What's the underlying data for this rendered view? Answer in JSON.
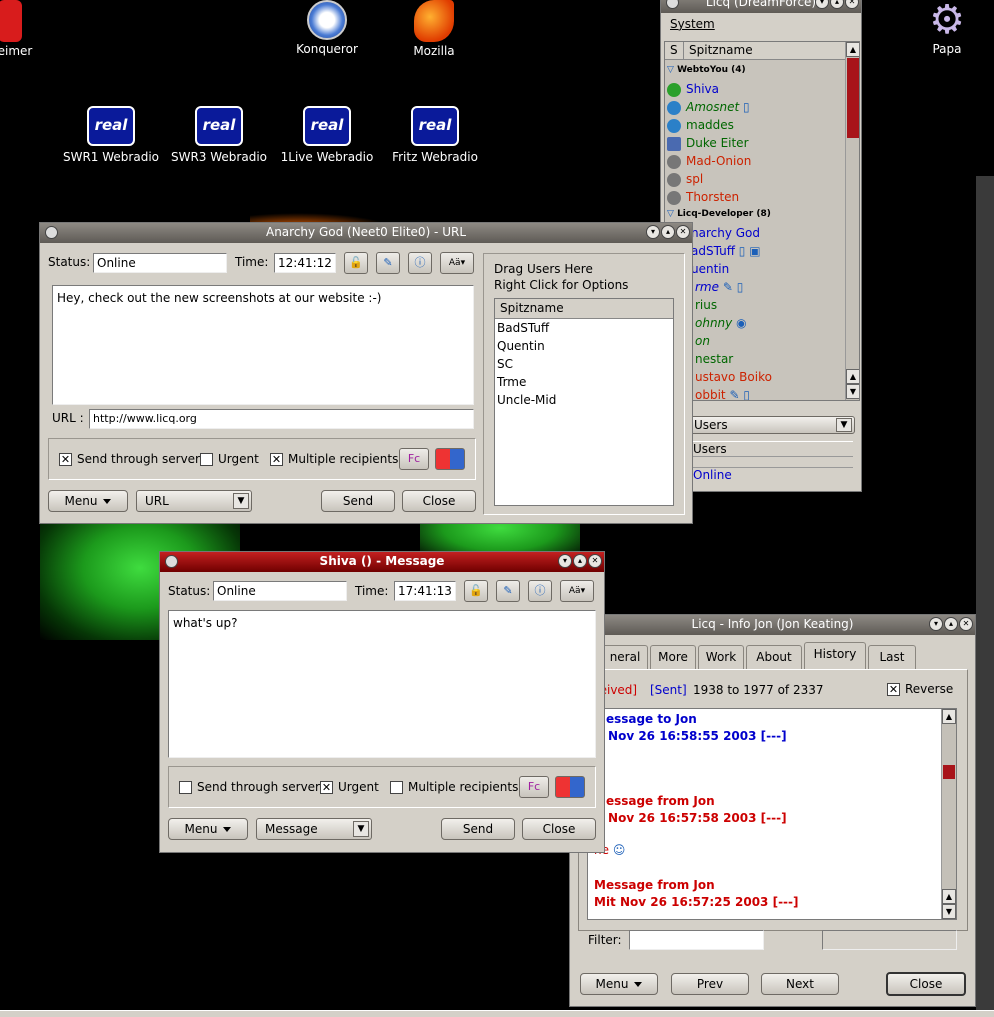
{
  "desktop": {
    "icons": [
      {
        "label": "eimer",
        "icon": "partial-red-icon"
      },
      {
        "label": "Konqueror",
        "icon": "konqueror-compass-icon"
      },
      {
        "label": "Mozilla",
        "icon": "mozilla-dragon-icon"
      },
      {
        "label": "Papa",
        "icon": "gear-icon"
      },
      {
        "label": "SWR1 Webradio",
        "icon": "real-icon"
      },
      {
        "label": "SWR3 Webradio",
        "icon": "real-icon"
      },
      {
        "label": "1Live Webradio",
        "icon": "real-icon"
      },
      {
        "label": "Fritz Webradio",
        "icon": "real-icon"
      }
    ],
    "real_text": "real"
  },
  "contact_list": {
    "title": "Licq (DreamForce)",
    "menu": "System",
    "col_s": "S",
    "col_name": "Spitzname",
    "groups": [
      {
        "name": "WebtoYou (4)",
        "contacts": [
          {
            "name": "Shiva",
            "color": "#0000cc",
            "italic": false,
            "status": "online"
          },
          {
            "name": "Amosnet",
            "color": "#006600",
            "italic": true,
            "status": "online-globe"
          },
          {
            "name": "maddes",
            "color": "#006600",
            "italic": false,
            "status": "online-globe"
          },
          {
            "name": "Duke Eiter",
            "color": "#006600",
            "italic": false,
            "status": "na"
          },
          {
            "name": "Mad-Onion",
            "color": "#cc2200",
            "italic": false,
            "status": "offline"
          },
          {
            "name": "spl",
            "color": "#cc2200",
            "italic": false,
            "status": "offline"
          },
          {
            "name": "Thorsten",
            "color": "#cc2200",
            "italic": false,
            "status": "offline"
          }
        ]
      },
      {
        "name": "Licq-Developer (8)",
        "contacts": [
          {
            "name": "Anarchy God",
            "color": "#0000cc",
            "italic": false
          },
          {
            "name": "BadSTuff",
            "color": "#0000cc",
            "italic": false
          },
          {
            "name": "Quentin",
            "color": "#0000cc",
            "italic": false
          },
          {
            "name": "Trme",
            "color": "#0000cc",
            "italic": true
          },
          {
            "name": "Darius",
            "color": "#006600",
            "italic": false
          },
          {
            "name": "Johnny",
            "color": "#006600",
            "italic": true
          },
          {
            "name": "Jon",
            "color": "#006600",
            "italic": true
          },
          {
            "name": "Genestar",
            "color": "#006600",
            "italic": false
          },
          {
            "name": "Gustavo Boiko",
            "color": "#cc2200",
            "italic": false
          },
          {
            "name": "Robbit",
            "color": "#cc2200",
            "italic": false
          }
        ]
      }
    ],
    "visible_names": [
      "Shiva",
      "Amosnet",
      "maddes",
      "Duke Eiter",
      "Mad-Onion",
      "spl",
      "Thorsten",
      "narchy God",
      "adSTuff",
      "uentin",
      "rme",
      "rius",
      "ohnny",
      "on",
      "nestar",
      "ustavo Boiko",
      "obbit"
    ],
    "bottom_users_combo": "Users",
    "bottom_users_label": "Users",
    "bottom_status": "Online"
  },
  "url_window": {
    "title": "Anarchy God (Neet0 Elite0) - URL",
    "status_label": "Status:",
    "status_value": "Online",
    "time_label": "Time:",
    "time_value": "12:41:12",
    "message": "Hey, check out the new screenshots at our website :-)",
    "url_label": "URL :",
    "url_value": "http://www.licq.org",
    "send_through_server": "Send through server",
    "urgent": "Urgent",
    "multiple_recipients": "Multiple recipients",
    "menu_button": "Menu",
    "type_combo": "URL",
    "send_button": "Send",
    "close_button": "Close",
    "drag_hint_1": "Drag Users Here",
    "drag_hint_2": "Right Click for Options",
    "recipients_header": "Spitzname",
    "recipients": [
      "BadSTuff",
      "Quentin",
      "SC",
      "Trme",
      "Uncle-Mid"
    ],
    "send_through_server_checked": true,
    "urgent_checked": false,
    "multiple_checked": true
  },
  "message_window": {
    "title": "Shiva () - Message",
    "status_label": "Status:",
    "status_value": "Online",
    "time_label": "Time:",
    "time_value": "17:41:13",
    "message": "what's up?",
    "send_through_server": "Send through server",
    "urgent": "Urgent",
    "multiple_recipients": "Multiple recipients",
    "menu_button": "Menu",
    "type_combo": "Message",
    "send_button": "Send",
    "close_button": "Close",
    "send_through_server_checked": false,
    "urgent_checked": true,
    "multiple_checked": false
  },
  "info_window": {
    "title": "Licq - Info Jon (Jon Keating)",
    "tabs": [
      "neral",
      "More",
      "Work",
      "About",
      "History",
      "Last"
    ],
    "active_tab": "History",
    "history_header_received": "ceived]",
    "history_header_sent": "[Sent]",
    "history_range": "1938 to 1977 of 2337",
    "reverse_label": "Reverse",
    "entries": [
      {
        "line1": "Message to Jon",
        "line2": "it Nov 26 16:58:55 2003 [---]",
        "body": "e",
        "color": "#0000cc"
      },
      {
        "line1": "Message from Jon",
        "line2": "it Nov 26 16:57:58 2003 [---]",
        "body": "ne",
        "color": "#cc0000"
      },
      {
        "line1": "Message from Jon",
        "line2": "Mit Nov 26 16:57:25 2003 [---]",
        "body": "",
        "color": "#cc0000"
      }
    ],
    "filter_label": "Filter:",
    "filter_value": "",
    "menu_button": "Menu",
    "prev_button": "Prev",
    "next_button": "Next",
    "close_button": "Close"
  }
}
